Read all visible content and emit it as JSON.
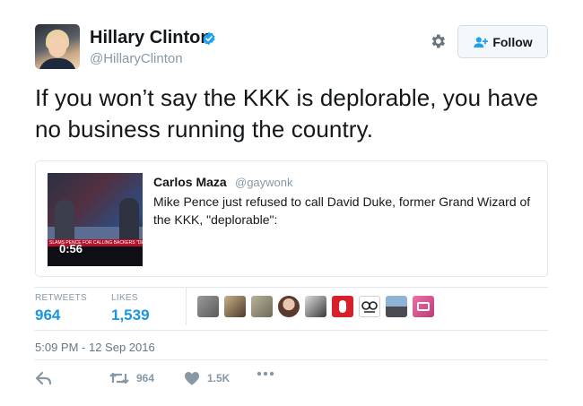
{
  "author": {
    "name": "Hillary Clinton",
    "handle": "@HillaryClinton",
    "verified_icon": "verified-badge-icon"
  },
  "header": {
    "settings_icon": "gear-icon",
    "follow_label": "Follow"
  },
  "tweet": {
    "text": "If you won’t say the KKK is deplorable, you have no business running the country."
  },
  "quoted_tweet": {
    "author_name": "Carlos Maza",
    "author_handle": "@gaywonk",
    "text": "Mike Pence just refused to call David Duke, former Grand Wizard of the KKK, \"deplorable\":",
    "video_duration": "0:56",
    "video_banner": "SLAMS PENCE FOR CALLING BACKERS \"DEPLORABLES\""
  },
  "stats": {
    "retweets_label": "RETWEETS",
    "retweets_value": "964",
    "likes_label": "LIKES",
    "likes_value": "1,539"
  },
  "likers_count_shown": 10,
  "timestamp": "5:09 PM - 12 Sep 2016",
  "actions": {
    "reply_icon": "reply-icon",
    "retweet_icon": "retweet-icon",
    "retweet_count": "964",
    "like_icon": "heart-icon",
    "like_count": "1.5K",
    "more_icon": "more-dots-icon"
  },
  "colors": {
    "link_blue": "#1b95e0",
    "verified_blue": "#1da1f2",
    "muted": "#8899a6",
    "border": "#e1e8ed"
  }
}
